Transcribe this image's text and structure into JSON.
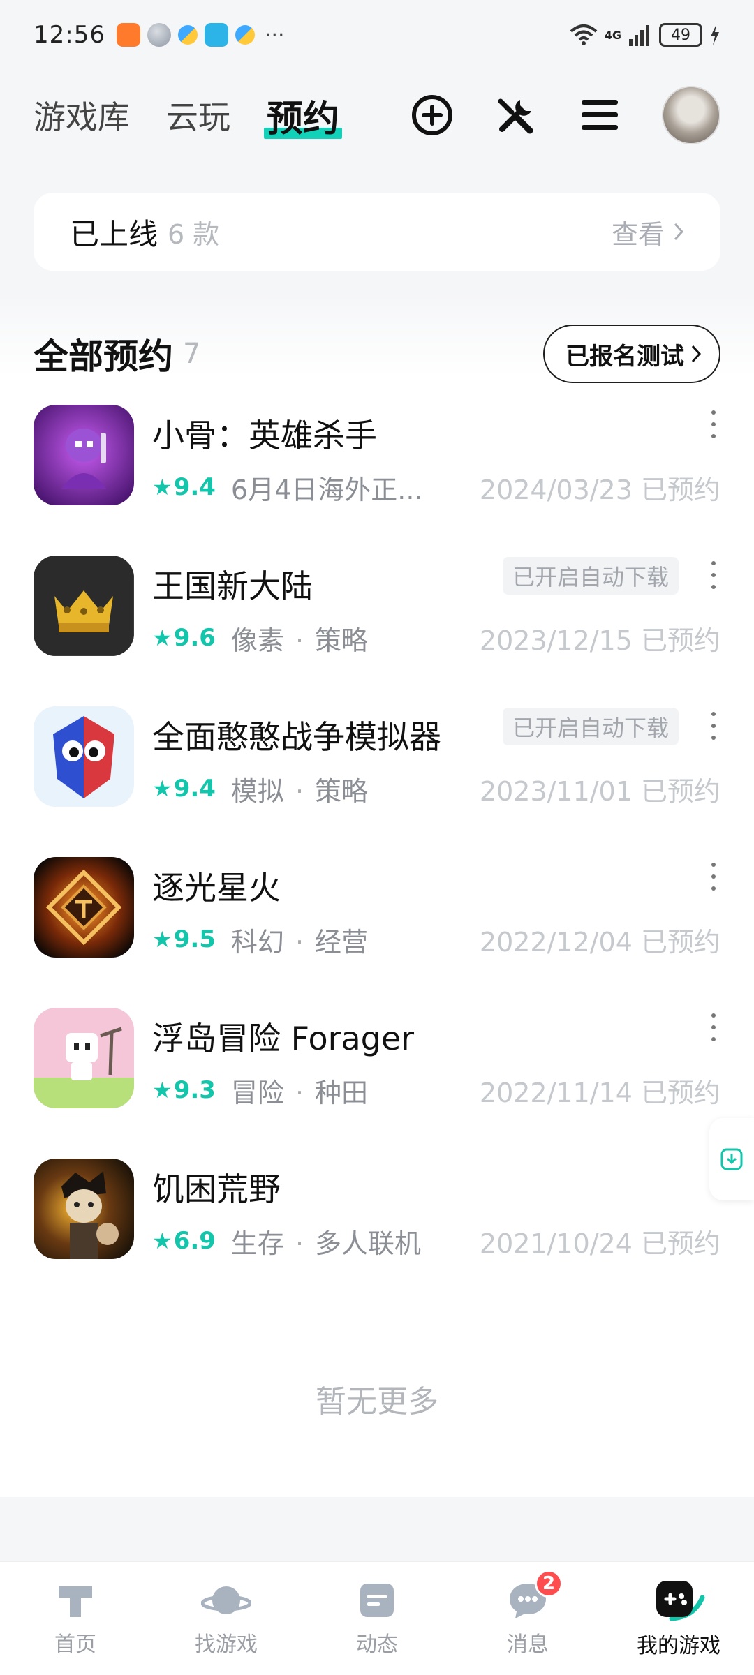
{
  "status_bar": {
    "time": "12:56",
    "network": "4G",
    "battery": "49",
    "more": "···"
  },
  "header": {
    "tabs": [
      {
        "label": "游戏库",
        "active": false
      },
      {
        "label": "云玩",
        "active": false
      },
      {
        "label": "预约",
        "active": true
      }
    ],
    "icons": [
      "add-circle-icon",
      "tools-icon",
      "menu-icon",
      "avatar"
    ]
  },
  "launched": {
    "label": "已上线",
    "count": "6 款",
    "view_label": "查看"
  },
  "section": {
    "title": "全部预约",
    "count": "7",
    "signup_button": "已报名测试"
  },
  "games": [
    {
      "name": "小骨：英雄杀手",
      "score": "9.4",
      "tags": [
        "6月4日海外正..."
      ],
      "date": "2024/03/23 已预约",
      "auto_download": "",
      "icon_style": "purple"
    },
    {
      "name": "王国新大陆",
      "score": "9.6",
      "tags": [
        "像素",
        "策略"
      ],
      "date": "2023/12/15 已预约",
      "auto_download": "已开启自动下载",
      "icon_style": "crown"
    },
    {
      "name": "全面憨憨战争模拟器",
      "score": "9.4",
      "tags": [
        "模拟",
        "策略"
      ],
      "date": "2023/11/01 已预约",
      "auto_download": "已开启自动下载",
      "icon_style": "tabs"
    },
    {
      "name": "逐光星火",
      "score": "9.5",
      "tags": [
        "科幻",
        "经营"
      ],
      "date": "2022/12/04 已预约",
      "auto_download": "",
      "icon_style": "gold"
    },
    {
      "name": "浮岛冒险 Forager",
      "score": "9.3",
      "tags": [
        "冒险",
        "种田"
      ],
      "date": "2022/11/14 已预约",
      "auto_download": "",
      "icon_style": "forager"
    },
    {
      "name": "饥困荒野",
      "score": "6.9",
      "tags": [
        "生存",
        "多人联机"
      ],
      "date": "2021/10/24 已预约",
      "auto_download": "",
      "icon_style": "dst"
    }
  ],
  "no_more": "暂无更多",
  "bottom_nav": [
    {
      "label": "首页",
      "icon": "home-t-icon",
      "active": false,
      "badge": ""
    },
    {
      "label": "找游戏",
      "icon": "planet-icon",
      "active": false,
      "badge": ""
    },
    {
      "label": "动态",
      "icon": "feed-icon",
      "active": false,
      "badge": ""
    },
    {
      "label": "消息",
      "icon": "message-icon",
      "active": false,
      "badge": "2"
    },
    {
      "label": "我的游戏",
      "icon": "gamepad-icon",
      "active": true,
      "badge": ""
    }
  ],
  "colors": {
    "accent": "#13c5ab",
    "tab_underline": "#12d1b9",
    "badge": "#ff4d4f"
  }
}
